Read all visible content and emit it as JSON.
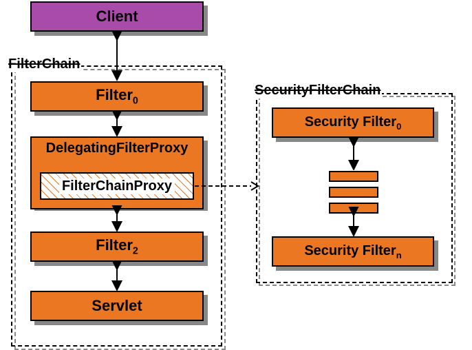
{
  "client": {
    "label": "Client"
  },
  "filterChain": {
    "title": "FilterChain",
    "filter0": "Filter",
    "filter0_sub": "0",
    "delegating": "DelegatingFilterProxy",
    "chainProxy": "FilterChainProxy",
    "filter2": "Filter",
    "filter2_sub": "2",
    "servlet": "Servlet"
  },
  "securityFilterChain": {
    "title": "SecurityFilterChain",
    "sf0": "Security Filter",
    "sf0_sub": "0",
    "sfn": "Security Filter",
    "sfn_sub": "n"
  }
}
